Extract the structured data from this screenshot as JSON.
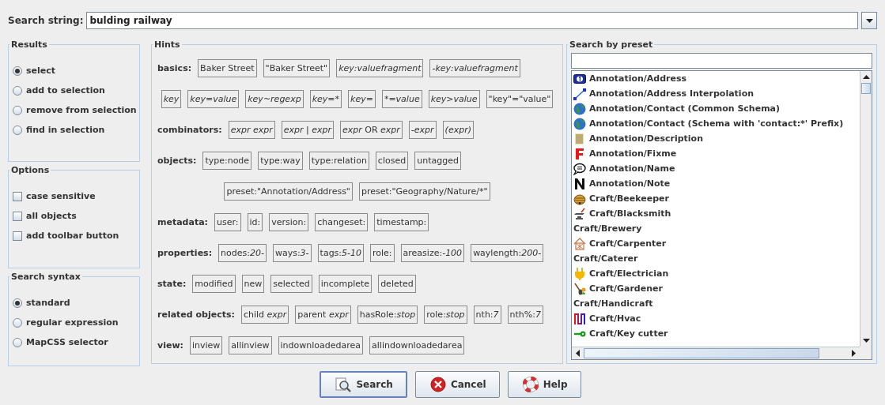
{
  "search_string": {
    "label": "Search string:",
    "value": "bulding railway"
  },
  "results": {
    "title": "Results",
    "options": [
      {
        "label": "select",
        "selected": true
      },
      {
        "label": "add to selection",
        "selected": false
      },
      {
        "label": "remove from selection",
        "selected": false
      },
      {
        "label": "find in selection",
        "selected": false
      }
    ]
  },
  "options": {
    "title": "Options",
    "items": [
      {
        "label": "case sensitive",
        "checked": false
      },
      {
        "label": "all objects",
        "checked": false
      },
      {
        "label": "add toolbar button",
        "checked": false
      }
    ]
  },
  "search_syntax": {
    "title": "Search syntax",
    "options": [
      {
        "label": "standard",
        "selected": true
      },
      {
        "label": "regular expression",
        "selected": false
      },
      {
        "label": "MapCSS selector",
        "selected": false
      }
    ]
  },
  "hints": {
    "title": "Hints",
    "groups": [
      {
        "label": "basics:",
        "lines": [
          [
            {
              "text": "Baker Street",
              "kind": "literal"
            },
            {
              "text": "\"Baker Street\"",
              "kind": "literal"
            },
            {
              "text": "key:valuefragment",
              "kind": "syntax"
            },
            {
              "text": "-key:valuefragment",
              "kind": "syntax"
            }
          ],
          [
            {
              "text": "key",
              "kind": "syntax"
            },
            {
              "text": "key=value",
              "kind": "syntax"
            },
            {
              "text": "key~regexp",
              "kind": "syntax"
            },
            {
              "text": "key=*",
              "kind": "syntax"
            },
            {
              "text": "key=",
              "kind": "syntax"
            },
            {
              "text": "*=value",
              "kind": "syntax"
            },
            {
              "text": "key>value",
              "kind": "syntax"
            },
            {
              "text": "\"key\"=\"value\"",
              "kind": "literal"
            }
          ]
        ]
      },
      {
        "label": "combinators:",
        "lines": [
          [
            {
              "text": "expr expr",
              "kind": "syntax"
            },
            {
              "text": "expr | expr",
              "kind": "syntax"
            },
            {
              "text": "*expr* OR *expr*",
              "kind": "mixed"
            },
            {
              "text": "-expr",
              "kind": "syntax"
            },
            {
              "text": "(expr)",
              "kind": "syntax"
            }
          ]
        ]
      },
      {
        "label": "objects:",
        "lines": [
          [
            {
              "text": "type:node",
              "kind": "literal"
            },
            {
              "text": "type:way",
              "kind": "literal"
            },
            {
              "text": "type:relation",
              "kind": "literal"
            },
            {
              "text": "closed",
              "kind": "literal"
            },
            {
              "text": "untagged",
              "kind": "literal"
            }
          ],
          [
            {
              "text": "preset:\"Annotation/Address\"",
              "kind": "literal"
            },
            {
              "text": "preset:\"Geography/Nature/*\"",
              "kind": "literal"
            }
          ]
        ]
      },
      {
        "label": "metadata:",
        "lines": [
          [
            {
              "text": "user:",
              "kind": "literal"
            },
            {
              "text": "id:",
              "kind": "literal"
            },
            {
              "text": "version:",
              "kind": "literal"
            },
            {
              "text": "changeset:",
              "kind": "literal"
            },
            {
              "text": "timestamp:",
              "kind": "literal"
            }
          ]
        ]
      },
      {
        "label": "properties:",
        "lines": [
          [
            {
              "text": "nodes:*20-*",
              "kind": "mixed"
            },
            {
              "text": "ways:*3-*",
              "kind": "mixed"
            },
            {
              "text": "tags:*5-10*",
              "kind": "mixed"
            },
            {
              "text": "role:",
              "kind": "literal"
            },
            {
              "text": "areasize:*-100*",
              "kind": "mixed"
            },
            {
              "text": "waylength:*200-*",
              "kind": "mixed"
            }
          ]
        ]
      },
      {
        "label": "state:",
        "lines": [
          [
            {
              "text": "modified",
              "kind": "literal"
            },
            {
              "text": "new",
              "kind": "literal"
            },
            {
              "text": "selected",
              "kind": "literal"
            },
            {
              "text": "incomplete",
              "kind": "literal"
            },
            {
              "text": "deleted",
              "kind": "literal"
            }
          ]
        ]
      },
      {
        "label": "related objects:",
        "lines": [
          [
            {
              "text": "child *expr*",
              "kind": "mixed"
            },
            {
              "text": "parent *expr*",
              "kind": "mixed"
            },
            {
              "text": "hasRole:*stop*",
              "kind": "mixed"
            },
            {
              "text": "role:*stop*",
              "kind": "mixed"
            },
            {
              "text": "nth:*7*",
              "kind": "mixed"
            },
            {
              "text": "nth%:*7*",
              "kind": "mixed"
            }
          ]
        ]
      },
      {
        "label": "view:",
        "lines": [
          [
            {
              "text": "inview",
              "kind": "literal"
            },
            {
              "text": "allinview",
              "kind": "literal"
            },
            {
              "text": "indownloadedarea",
              "kind": "literal"
            },
            {
              "text": "allindownloadedarea",
              "kind": "literal"
            }
          ]
        ]
      }
    ]
  },
  "preset_search": {
    "title": "Search by preset",
    "items": [
      {
        "label": "Annotation/Address",
        "kind": "plate"
      },
      {
        "label": "Annotation/Address Interpolation",
        "kind": "line"
      },
      {
        "label": "Annotation/Contact (Common Schema)",
        "kind": "globe"
      },
      {
        "label": "Annotation/Contact (Schema with 'contact:*' Prefix)",
        "kind": "globe"
      },
      {
        "label": "Annotation/Description",
        "kind": "lines"
      },
      {
        "label": "Annotation/Fixme",
        "kind": "letter-f"
      },
      {
        "label": "Annotation/Name",
        "kind": "speech"
      },
      {
        "label": "Annotation/Note",
        "kind": "letter-n"
      },
      {
        "label": "Craft/Beekeeper",
        "kind": "hive"
      },
      {
        "label": "Craft/Blacksmith",
        "kind": "anvil"
      },
      {
        "label": "Craft/Brewery",
        "kind": "plain"
      },
      {
        "label": "Craft/Carpenter",
        "kind": "house"
      },
      {
        "label": "Craft/Caterer",
        "kind": "plain"
      },
      {
        "label": "Craft/Electrician",
        "kind": "plug"
      },
      {
        "label": "Craft/Gardener",
        "kind": "shovel"
      },
      {
        "label": "Craft/Handicraft",
        "kind": "plain"
      },
      {
        "label": "Craft/Hvac",
        "kind": "zigzag"
      },
      {
        "label": "Craft/Key cutter",
        "kind": "key"
      }
    ]
  },
  "buttons": [
    {
      "label": "Search",
      "kind": "search"
    },
    {
      "label": "Cancel",
      "kind": "cancel"
    },
    {
      "label": "Help",
      "kind": "help"
    }
  ]
}
